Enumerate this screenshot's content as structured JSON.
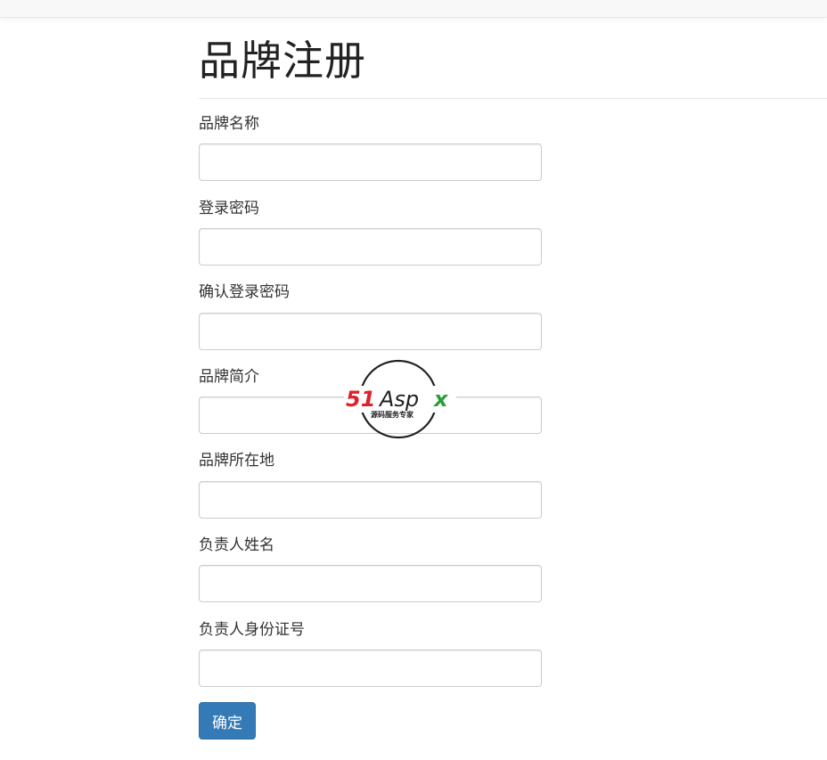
{
  "page": {
    "title": "品牌注册"
  },
  "form": {
    "fields": [
      {
        "label": "品牌名称",
        "value": "",
        "placeholder": ""
      },
      {
        "label": "登录密码",
        "value": "",
        "placeholder": ""
      },
      {
        "label": "确认登录密码",
        "value": "",
        "placeholder": ""
      },
      {
        "label": "品牌简介",
        "value": "",
        "placeholder": ""
      },
      {
        "label": "品牌所在地",
        "value": "",
        "placeholder": ""
      },
      {
        "label": "负责人姓名",
        "value": "",
        "placeholder": ""
      },
      {
        "label": "负责人身份证号",
        "value": "",
        "placeholder": ""
      }
    ],
    "submit_label": "确定"
  },
  "watermark": {
    "brand_red": "51",
    "brand_dark": "Asp",
    "brand_green": "x",
    "tagline": "源码服务专家"
  },
  "colors": {
    "primary": "#337ab7",
    "watermark_red": "#e0202a",
    "watermark_green": "#2a9d3a"
  }
}
